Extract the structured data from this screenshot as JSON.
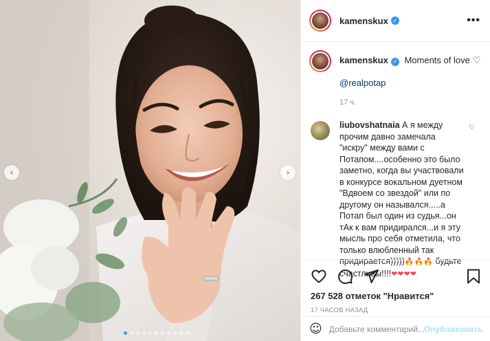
{
  "post": {
    "username": "kamenskux",
    "verified_icon": "verified-badge-icon",
    "more_label": "•••",
    "caption_text": "Moments of love",
    "caption_heart": "♡",
    "mention": "@realpotap",
    "caption_time": "17 ч."
  },
  "comment": {
    "username": "liubovshatnaia",
    "text": " А я между прочим давно замечала \"искру\" между вами с Потапом....особенно это было заметно, когда вы участвовали в конкурсе вокальном дуетном \"Вдвоем со звездой\" или по другому он назывался.....а Потап был один из судья...он тАк к вам придирался...и я эту мысль про себя отметила, что только влюбленный так придирается)))))",
    "fire_emojis": "🔥🔥🔥",
    "text_end": " будьте счастливы!!!!",
    "heart_emojis": "❤❤❤❤",
    "like_icon": "♡"
  },
  "actions": {
    "likes": "267 528 отметок \"Нравится\"",
    "date": "17 ЧАСОВ НАЗАД"
  },
  "add_comment": {
    "emoji_icon": "☺",
    "placeholder": "Добавьте комментарий...",
    "publish_label": "Опубликовать"
  },
  "carousel": {
    "prev": "‹",
    "next": "›",
    "slide_count": 11,
    "active_index": 0
  },
  "colors": {
    "accent": "#3897f0",
    "link": "#00376b",
    "heart_red": "#ed4956",
    "publish_disabled": "#b2dffc"
  }
}
